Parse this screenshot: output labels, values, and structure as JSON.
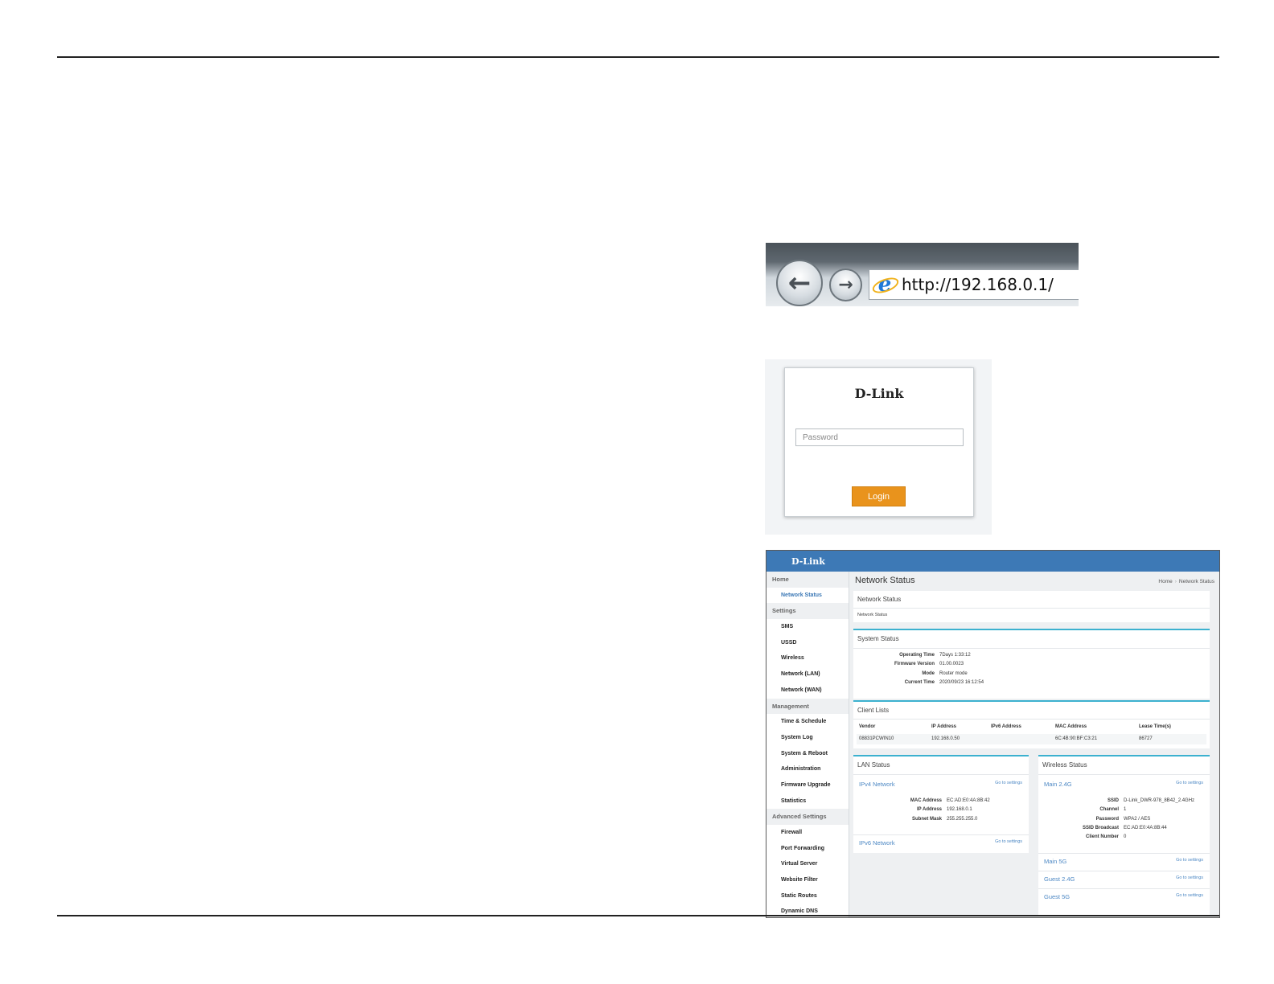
{
  "browser": {
    "back_icon": "←",
    "forward_icon": "→",
    "url": "http://192.168.0.1/",
    "ie_icon": "e"
  },
  "login": {
    "logo": "D-Link",
    "password_placeholder": "Password",
    "button": "Login",
    "accent": "#e9931c"
  },
  "router": {
    "logo": "D-Link",
    "header_color": "#3d79b6",
    "sidebar": {
      "home": "Home",
      "network_status": "Network Status",
      "settings": "Settings",
      "sms": "SMS",
      "ussd": "USSD",
      "wireless": "Wireless",
      "network_lan": "Network (LAN)",
      "network_wan": "Network (WAN)",
      "management": "Management",
      "time_schedule": "Time & Schedule",
      "system_log": "System Log",
      "system_reboot": "System & Reboot",
      "administration": "Administration",
      "firmware_upgrade": "Firmware Upgrade",
      "statistics": "Statistics",
      "advanced": "Advanced Settings",
      "firewall": "Firewall",
      "port_forwarding": "Port Forwarding",
      "virtual_server": "Virtual Server",
      "website_filter": "Website Filter",
      "static_routes": "Static Routes",
      "dynamic_dns": "Dynamic DNS"
    },
    "page_title": "Network Status",
    "breadcrumb": {
      "home": "Home",
      "sep": "›",
      "current": "Network Status"
    },
    "network_status": {
      "title": "Network Status",
      "text": "Network Status"
    },
    "system_status": {
      "title": "System Status",
      "rows": [
        {
          "label": "Operating Time",
          "value": "7Days 1:33:12"
        },
        {
          "label": "Firmware Version",
          "value": "01.00.0023"
        },
        {
          "label": "Mode",
          "value": "Router mode"
        },
        {
          "label": "Current Time",
          "value": "2020/09/23 16:12:54"
        }
      ]
    },
    "client_lists": {
      "title": "Client Lists",
      "headers": {
        "vendor": "Vendor",
        "ip": "IP Address",
        "ipv6": "IPv6 Address",
        "mac": "MAC Address",
        "lease": "Lease Time(s)"
      },
      "row": {
        "vendor": "08831PCWIN10",
        "ip": "192.168.0.50",
        "ipv6": "",
        "mac": "6C:4B:90:BF:C3:21",
        "lease": "86727"
      }
    },
    "lan_status": {
      "title": "LAN Status",
      "ipv4_label": "IPv4 Network",
      "goto": "Go to settings",
      "rows": [
        {
          "label": "MAC Address",
          "value": "EC:AD:E0:4A:8B:42"
        },
        {
          "label": "IP Address",
          "value": "192.168.0.1"
        },
        {
          "label": "Subnet Mask",
          "value": "255.255.255.0"
        }
      ],
      "ipv6_label": "IPv6 Network",
      "ipv6_goto": "Go to settings"
    },
    "wireless_status": {
      "title": "Wireless Status",
      "main24_label": "Main 2.4G",
      "goto": "Go to settings",
      "rows": [
        {
          "label": "SSID",
          "value": "D-Link_DWR-978_8B42_2.4GHz"
        },
        {
          "label": "Channel",
          "value": "1"
        },
        {
          "label": "Password",
          "value": "WPA2 / AES"
        },
        {
          "label": "SSID Broadcast",
          "value": "EC:AD:E0:4A:8B:44"
        },
        {
          "label": "Client Number",
          "value": "0"
        }
      ],
      "main5_label": "Main 5G",
      "main5_goto": "Go to settings",
      "guest24_label": "Guest 2.4G",
      "guest24_goto": "Go to settings",
      "guest5_label": "Guest 5G",
      "guest5_goto": "Go to settings"
    }
  }
}
